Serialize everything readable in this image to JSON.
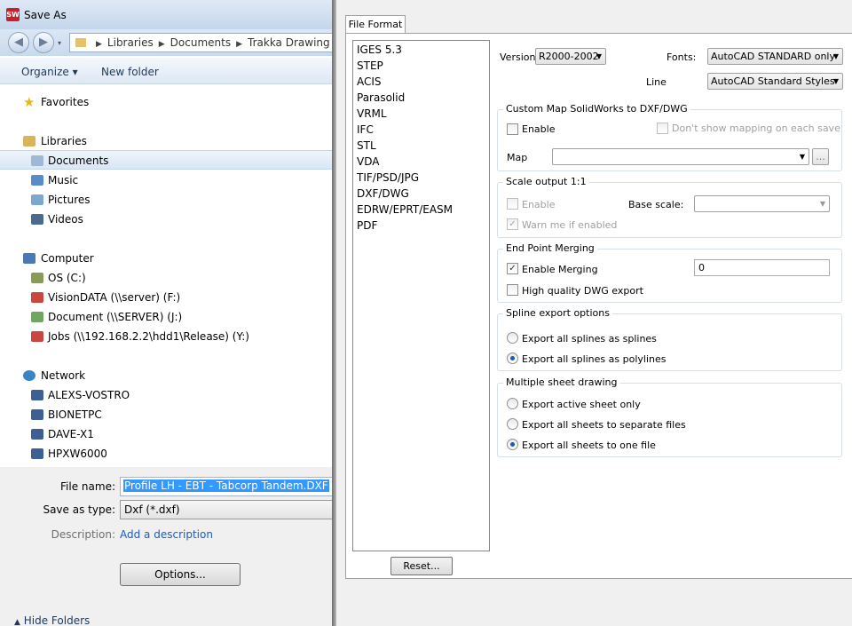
{
  "window": {
    "title": "Save As",
    "app_icon_text": "SW"
  },
  "nav": {
    "back_icon": "back-arrow-icon",
    "forward_icon": "forward-arrow-icon",
    "breadcrumb": [
      "Libraries",
      "Documents",
      "Trakka Drawing - Sc"
    ]
  },
  "toolbar": {
    "organize": "Organize ▾",
    "new_folder": "New folder"
  },
  "navpane": {
    "favorites": "Favorites",
    "libraries": "Libraries",
    "library_items": [
      "Documents",
      "Music",
      "Pictures",
      "Videos"
    ],
    "computer": "Computer",
    "drives": [
      "OS (C:)",
      "VisionDATA (\\\\server) (F:)",
      "Document (\\\\SERVER) (J:)",
      "Jobs (\\\\192.168.2.2\\hdd1\\Release) (Y:)"
    ],
    "network": "Network",
    "network_items": [
      "ALEXS-VOSTRO",
      "BIONETPC",
      "DAVE-X1",
      "HPXW6000"
    ]
  },
  "fields": {
    "file_name_label": "File name:",
    "file_name_value": "Profile LH - EBT - Tabcorp Tandem.DXF",
    "save_type_label": "Save as type:",
    "save_type_value": "Dxf (*.dxf)",
    "description_label": "Description:",
    "description_link": "Add a description",
    "options_button": "Options...",
    "hide_folders": "Hide Folders"
  },
  "dialog": {
    "tab": "File Format",
    "formats": [
      "IGES 5.3",
      "STEP",
      "ACIS",
      "Parasolid",
      "VRML",
      "IFC",
      "STL",
      "VDA",
      "TIF/PSD/JPG",
      "DXF/DWG",
      "EDRW/EPRT/EASM",
      "PDF"
    ],
    "reset_button": "Reset...",
    "version_label": "Version:",
    "version_value": "R2000-2002",
    "fonts_label": "Fonts:",
    "fonts_value": "AutoCAD STANDARD only",
    "line_label": "Line",
    "line_value": "AutoCAD Standard Styles",
    "custom_map": {
      "title": "Custom Map SolidWorks to DXF/DWG",
      "enable": "Enable",
      "enable_checked": false,
      "dont_show": "Don't show mapping on each save",
      "map_label": "Map",
      "map_value": "",
      "browse": "..."
    },
    "scale": {
      "title": "Scale output 1:1",
      "enable": "Enable",
      "base_scale_label": "Base scale:",
      "warn": "Warn me if enabled"
    },
    "endpoint": {
      "title": "End Point Merging",
      "enable_merging": "Enable Merging",
      "enable_merging_checked": true,
      "merge_value": "0",
      "hq_export": "High quality DWG export",
      "hq_checked": false
    },
    "spline": {
      "title": "Spline export options",
      "options": [
        "Export all splines as splines",
        "Export all splines as polylines"
      ],
      "selected": 1
    },
    "multisheet": {
      "title": "Multiple sheet drawing",
      "options": [
        "Export active sheet only",
        "Export all sheets to separate files",
        "Export all sheets to one file"
      ],
      "selected": 2
    }
  }
}
